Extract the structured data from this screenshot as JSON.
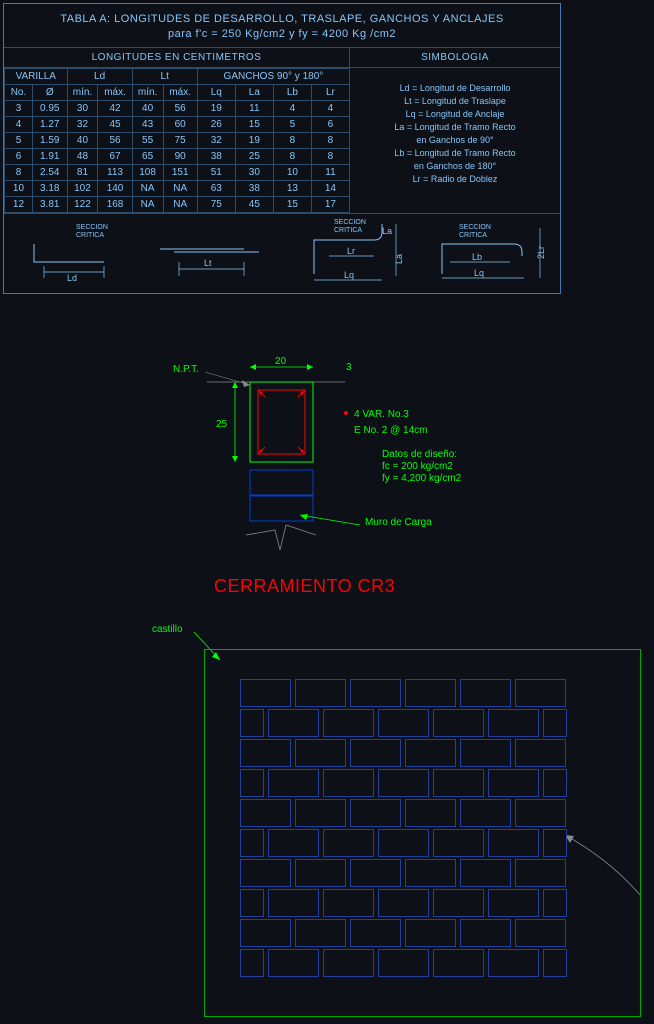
{
  "table": {
    "title_l1": "TABLA A: LONGITUDES DE DESARROLLO, TRASLAPE, GANCHOS Y ANCLAJES",
    "title_l2": "para f'c = 250 Kg/cm2 y fy = 4200 Kg /cm2",
    "sec_lon": "LONGITUDES EN CENTIMETROS",
    "sec_sim": "SIMBOLOGIA",
    "grp_varilla": "VARILLA",
    "grp_ld": "Ld",
    "grp_lt": "Lt",
    "grp_ganchos": "GANCHOS 90° y 180°",
    "h_no": "No.",
    "h_diam": "Ø",
    "h_min1": "mín.",
    "h_max1": "máx.",
    "h_min2": "mín.",
    "h_max2": "máx.",
    "h_lq": "Lq",
    "h_la": "La",
    "h_lb": "Lb",
    "h_lr": "Lr",
    "rows": [
      [
        "3",
        "0.95",
        "30",
        "42",
        "40",
        "56",
        "19",
        "11",
        "4",
        "4"
      ],
      [
        "4",
        "1.27",
        "32",
        "45",
        "43",
        "60",
        "26",
        "15",
        "5",
        "6"
      ],
      [
        "5",
        "1.59",
        "40",
        "56",
        "55",
        "75",
        "32",
        "19",
        "8",
        "8"
      ],
      [
        "6",
        "1.91",
        "48",
        "67",
        "65",
        "90",
        "38",
        "25",
        "8",
        "8"
      ],
      [
        "8",
        "2.54",
        "81",
        "113",
        "108",
        "151",
        "51",
        "30",
        "10",
        "11"
      ],
      [
        "10",
        "3.18",
        "102",
        "140",
        "NA",
        "NA",
        "63",
        "38",
        "13",
        "14"
      ],
      [
        "12",
        "3.81",
        "122",
        "168",
        "NA",
        "NA",
        "75",
        "45",
        "15",
        "17"
      ]
    ],
    "sym": {
      "l1": "Ld = Longitud de Desarrollo",
      "l2": "Lt = Longitud de Traslape",
      "l3": "Lq = Longitud de Anclaje",
      "l4": "La = Longitud de Tramo Recto",
      "l5": "en Ganchos de 90°",
      "l6": "Lb = Longitud de Tramo Recto",
      "l7": "en Ganchos de 180°",
      "l8": "Lr = Radio de Doblez"
    },
    "seccion": "SECCION",
    "critica": "CRITICA",
    "d_ld": "Ld",
    "d_lt": "Lt",
    "d_lq": "Lq",
    "d_la": "La",
    "d_lb": "Lb",
    "d_lr": "Lr",
    "d_2lr": "2Lr"
  },
  "cerr": {
    "npt": "N.P.T.",
    "dim_20": "20",
    "dim_3": "3",
    "dim_25": "25",
    "var_label": "4 VAR. No.3",
    "est_label": "E No. 2 @ 14cm",
    "datos_title": "Datos de diseño:",
    "datos_fc": "fc = 200 kg/cm2",
    "datos_fy": "fy = 4,200 kg/cm2",
    "muro": "Muro de Carga",
    "title": "CERRAMIENTO CR3",
    "castillo": "castillo"
  }
}
